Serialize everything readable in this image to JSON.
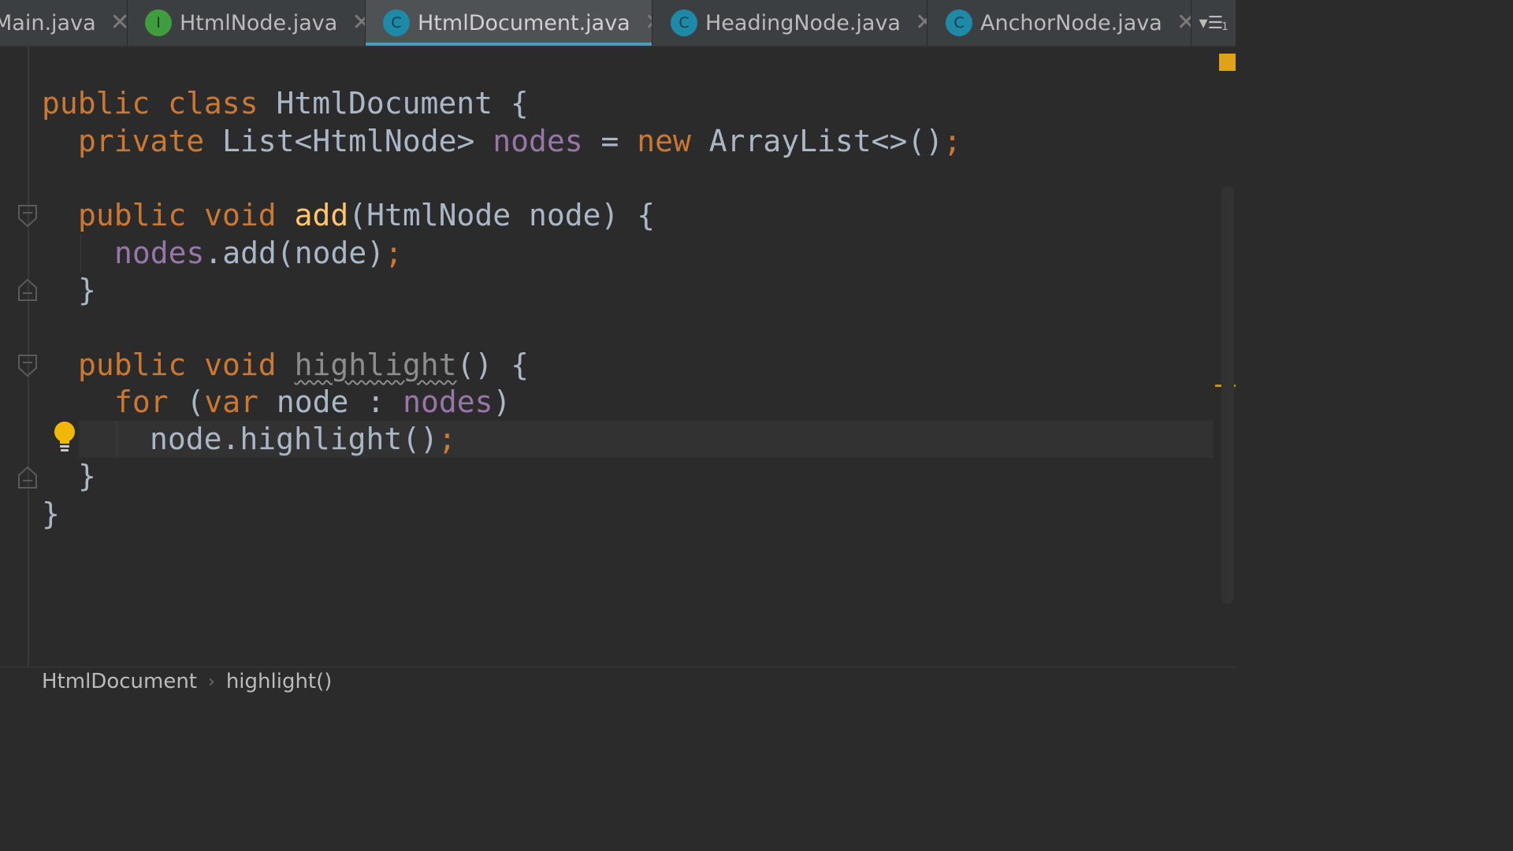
{
  "tabs": [
    {
      "label": "Main.java",
      "kind": "class",
      "badge": "",
      "active": false
    },
    {
      "label": "HtmlNode.java",
      "kind": "interface",
      "badge": "I",
      "active": false
    },
    {
      "label": "HtmlDocument.java",
      "kind": "class",
      "badge": "C",
      "active": true
    },
    {
      "label": "HeadingNode.java",
      "kind": "class",
      "badge": "C",
      "active": false
    },
    {
      "label": "AnchorNode.java",
      "kind": "class",
      "badge": "C",
      "active": false
    }
  ],
  "tab_close_glyph": "✕",
  "tab_overflow": {
    "icon": "tab-list-icon",
    "count": "1"
  },
  "code": {
    "line1": {
      "t1": "public",
      "t2": " ",
      "t3": "class",
      "t4": " HtmlDocument {"
    },
    "line2": {
      "t1": "private",
      "t2": " List<HtmlNode> ",
      "t3": "nodes",
      "t4": " = ",
      "t5": "new",
      "t6": " ArrayList<>()",
      "t7": ";"
    },
    "line4": {
      "t1": "public",
      "t2": " ",
      "t3": "void",
      "t4": " ",
      "t5": "add",
      "t6": "(HtmlNode node) {"
    },
    "line5": {
      "t1": "nodes",
      "t2": ".add(node)",
      "t3": ";"
    },
    "line6": {
      "t1": "}"
    },
    "line8": {
      "t1": "public",
      "t2": " ",
      "t3": "void",
      "t4": " ",
      "t5": "highlight",
      "t6": "() {"
    },
    "line9": {
      "t1": "for",
      "t2": " (",
      "t3": "var",
      "t4": " node : ",
      "t5": "nodes",
      "t6": ")"
    },
    "line10": {
      "t1": "node.highlight()",
      "t2": ";"
    },
    "line11": {
      "t1": "}"
    },
    "line12": {
      "t1": "}"
    }
  },
  "breadcrumb": {
    "item1": "HtmlDocument",
    "separator": "›",
    "item2": "highlight()"
  },
  "colors": {
    "keyword": "#cc7832",
    "field": "#9876aa",
    "method_decl": "#ffc66d",
    "text": "#a9b7c6",
    "active_tab_underline": "#4a9cbf",
    "warning_marker": "#e0a317"
  }
}
